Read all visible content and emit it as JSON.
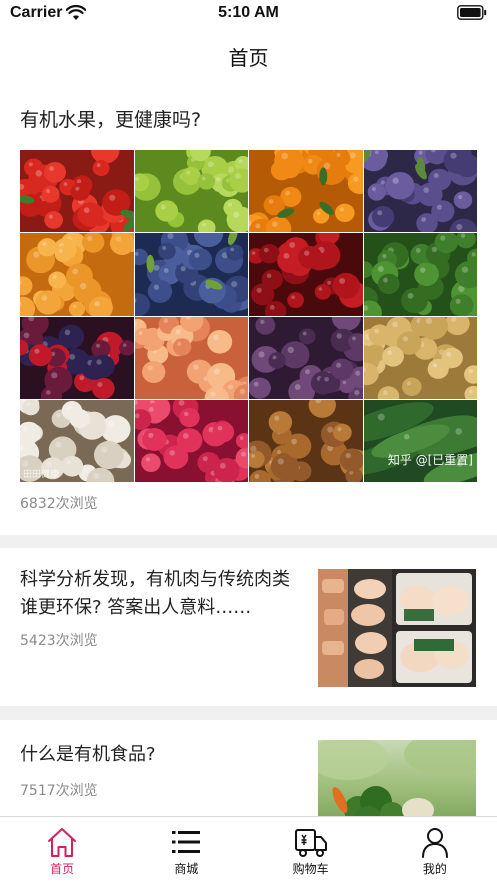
{
  "status_bar": {
    "carrier": "Carrier",
    "time": "5:10 AM"
  },
  "nav": {
    "title": "首页"
  },
  "articles": [
    {
      "title": "有机水果，更健康吗?",
      "views": "6832次浏览",
      "image_watermark_left": "田田健康",
      "image_watermark_right": "知乎 @[已重置]"
    },
    {
      "title": "科学分析发现，有机肉与传统肉类谁更环保? 答案出人意料……",
      "views": "5423次浏览"
    },
    {
      "title": "什么是有机食品?",
      "views": "7517次浏览"
    }
  ],
  "tabs": [
    {
      "label": "首页",
      "icon": "home-icon",
      "active": true
    },
    {
      "label": "商城",
      "icon": "list-icon",
      "active": false
    },
    {
      "label": "购物车",
      "icon": "truck-icon",
      "active": false
    },
    {
      "label": "我的",
      "icon": "user-icon",
      "active": false
    }
  ],
  "colors": {
    "accent": "#d81e5b",
    "views_text": "#8a8a8a",
    "separator": "#f0f0f0"
  },
  "produce_tiles": [
    "strawberries",
    "green grapes",
    "oranges",
    "plums",
    "apricots",
    "blueberries",
    "cherries",
    "broccoli",
    "mixed berries",
    "peaches",
    "figs",
    "potatoes",
    "mushrooms",
    "raspberries",
    "hazelnuts",
    "cucumbers"
  ]
}
